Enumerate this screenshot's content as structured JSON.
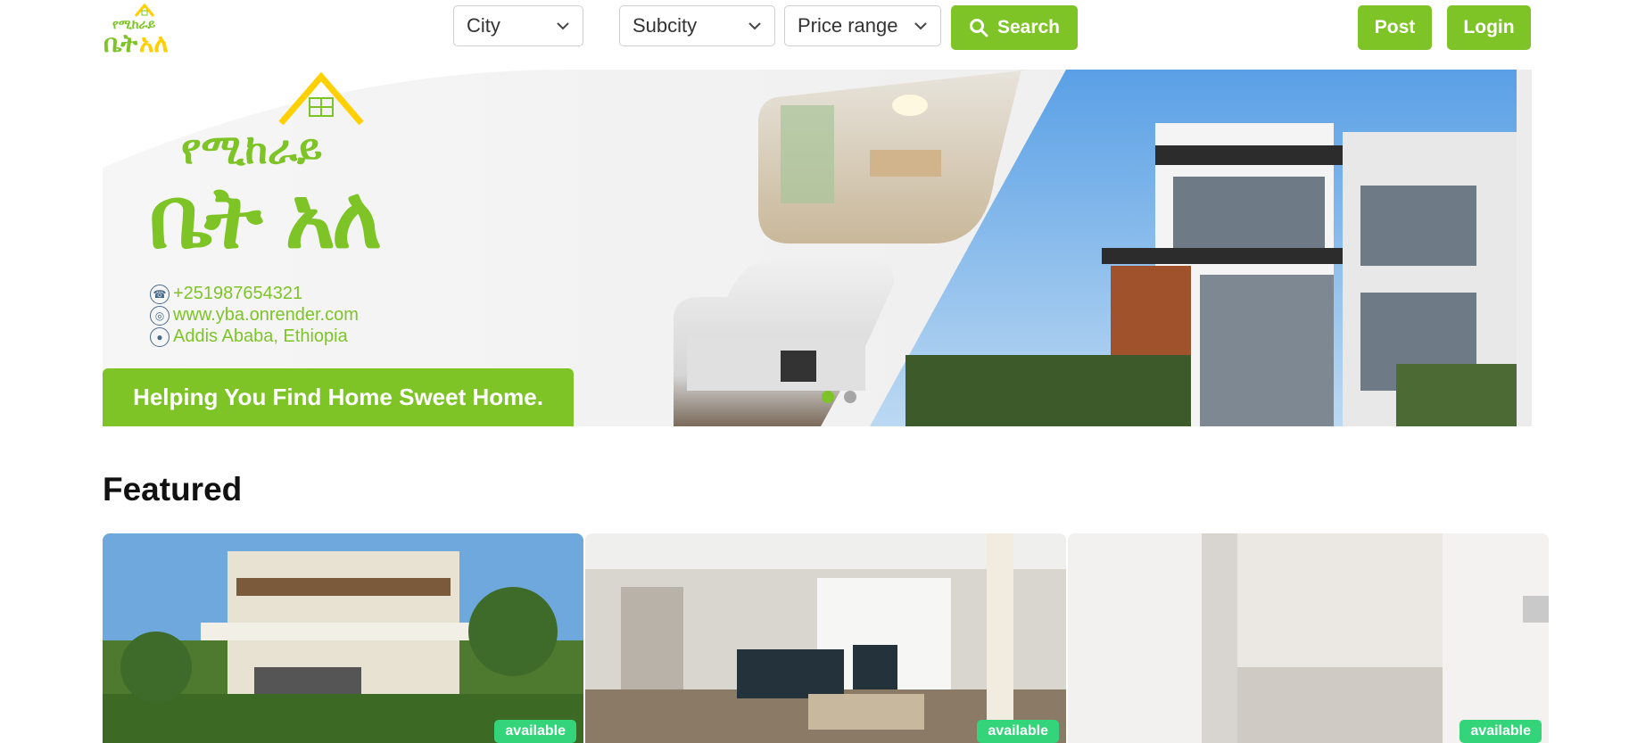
{
  "header": {
    "logo_alt": "የሚከራይ ቤት አለ",
    "filters": [
      {
        "label": "City"
      },
      {
        "label": "Subcity"
      },
      {
        "label": "Price range"
      }
    ],
    "search_label": "Search",
    "post_label": "Post",
    "login_label": "Login"
  },
  "banner": {
    "brand_line1": "የሚከራይ",
    "brand_line2": "ቤት አለ",
    "phone": "+251987654321",
    "website": "www.yba.onrender.com",
    "address": "Addis Ababa, Ethiopia",
    "tagline": "Helping You Find Home Sweet Home.",
    "slides": 2,
    "active_slide": 1
  },
  "featured": {
    "title": "Featured",
    "cards": [
      {
        "status": "available"
      },
      {
        "status": "available"
      },
      {
        "status": "available"
      }
    ]
  },
  "colors": {
    "accent": "#7ec427",
    "badge": "#33d47a",
    "logo_yellow": "#ffd000"
  }
}
